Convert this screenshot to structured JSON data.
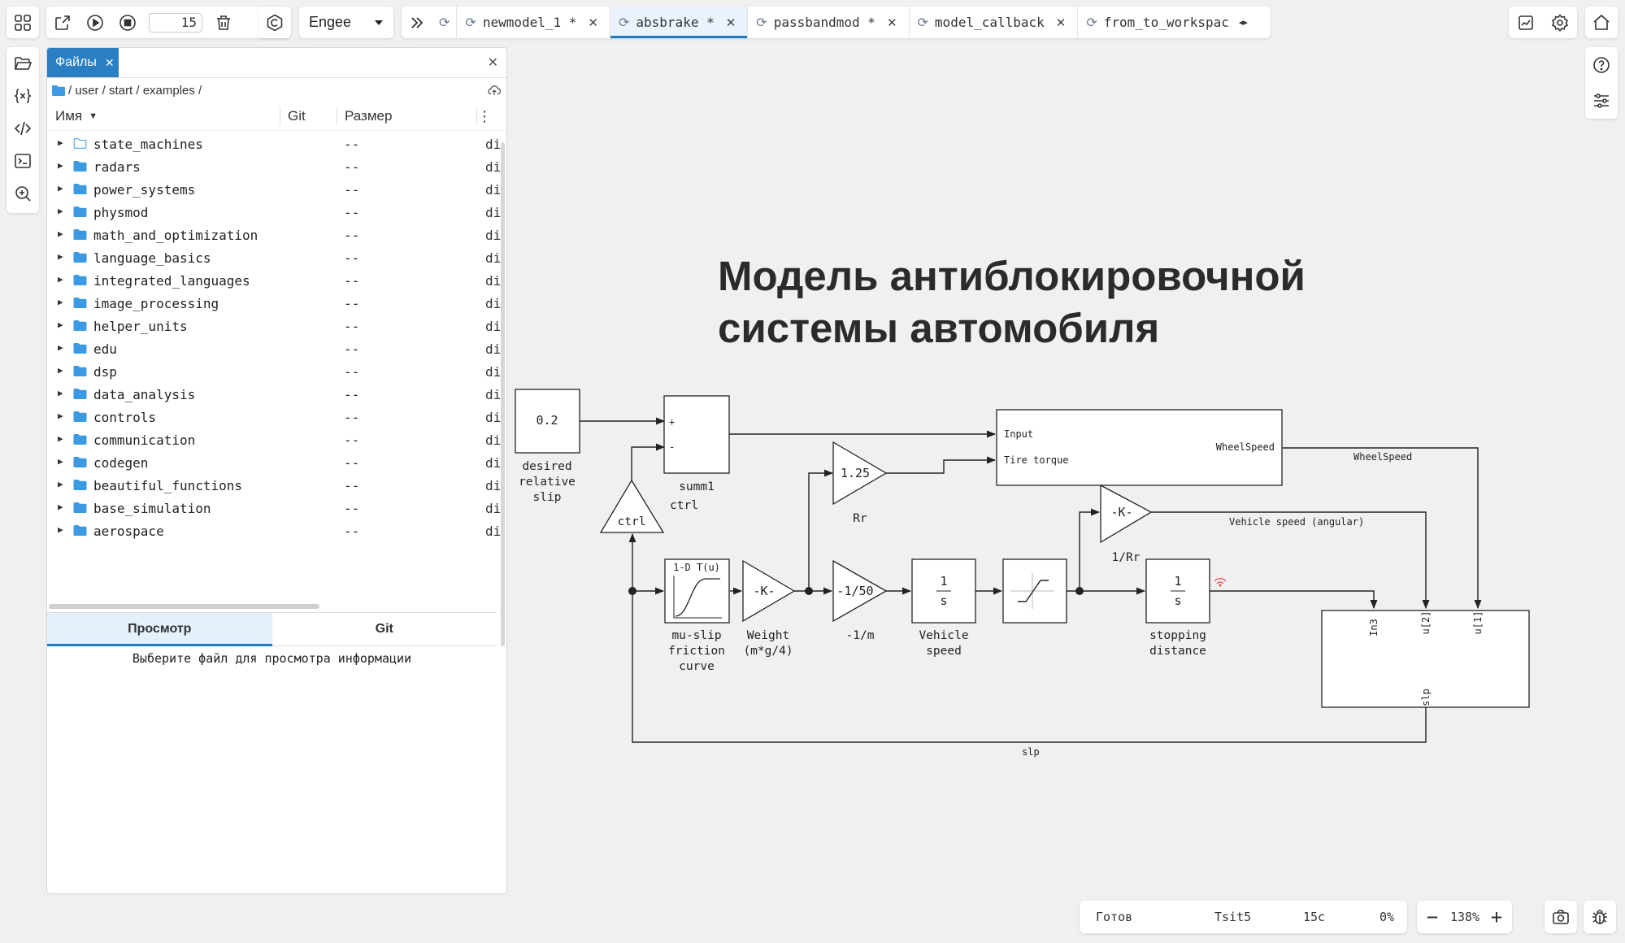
{
  "toolbar": {
    "steps_value": "15",
    "solver_selected": "Engee"
  },
  "tabs": [
    {
      "label": "newmodel_1 *",
      "active": false
    },
    {
      "label": "absbrake *",
      "active": true
    },
    {
      "label": "passbandmod *",
      "active": false
    },
    {
      "label": "model_callback",
      "active": false
    },
    {
      "label": "from_to_workspac",
      "active": false
    }
  ],
  "panel": {
    "tab_label": "Файлы",
    "path": "/ user / start / examples /",
    "columns": {
      "name": "Имя",
      "git": "Git",
      "size": "Размер"
    },
    "files": [
      {
        "name": "state_machines",
        "size": "--",
        "ext": "di"
      },
      {
        "name": "radars",
        "size": "--",
        "ext": "di"
      },
      {
        "name": "power_systems",
        "size": "--",
        "ext": "di"
      },
      {
        "name": "physmod",
        "size": "--",
        "ext": "di"
      },
      {
        "name": "math_and_optimization",
        "size": "--",
        "ext": "di"
      },
      {
        "name": "language_basics",
        "size": "--",
        "ext": "di"
      },
      {
        "name": "integrated_languages",
        "size": "--",
        "ext": "di"
      },
      {
        "name": "image_processing",
        "size": "--",
        "ext": "di"
      },
      {
        "name": "helper_units",
        "size": "--",
        "ext": "di"
      },
      {
        "name": "edu",
        "size": "--",
        "ext": "di"
      },
      {
        "name": "dsp",
        "size": "--",
        "ext": "di"
      },
      {
        "name": "data_analysis",
        "size": "--",
        "ext": "di"
      },
      {
        "name": "controls",
        "size": "--",
        "ext": "di"
      },
      {
        "name": "communication",
        "size": "--",
        "ext": "di"
      },
      {
        "name": "codegen",
        "size": "--",
        "ext": "di"
      },
      {
        "name": "beautiful_functions",
        "size": "--",
        "ext": "di"
      },
      {
        "name": "base_simulation",
        "size": "--",
        "ext": "di"
      },
      {
        "name": "aerospace",
        "size": "--",
        "ext": "di"
      }
    ],
    "subtabs": {
      "preview": "Просмотр",
      "git": "Git"
    },
    "preview_message": "Выберите файл для просмотра информации"
  },
  "diagram": {
    "title_line1": "Модель антиблокировочной",
    "title_line2": "системы автомобиля",
    "blocks": {
      "const_value": "0.2",
      "const_label": [
        "desired",
        "relative",
        "slip"
      ],
      "sum_label": "summ1",
      "sum_plus": "+",
      "sum_minus": "-",
      "ctrl_inner": "ctrl",
      "ctrl_label": "ctrl",
      "rr_value": "1.25",
      "rr_label": "Rr",
      "subsys_in1": "Input",
      "subsys_in2": "Tire torque",
      "subsys_out": "WheelSpeed",
      "wheelspeed_signal": "WheelSpeed",
      "k_value": "-K-",
      "k_label": "1/Rr",
      "vehicle_speed_signal": "Vehicle speed (angular)",
      "lookup_header": "1-D T(u)",
      "lookup_label": [
        "mu-slip",
        "friction",
        "curve"
      ],
      "weight_value": "-K-",
      "weight_label": [
        "Weight",
        "(m*g/4)"
      ],
      "gain_value": "-1/50",
      "gain_label": "-1/m",
      "int1_num": "1",
      "int1_den": "s",
      "int1_label": [
        "Vehicle",
        "speed"
      ],
      "int2_num": "1",
      "int2_den": "s",
      "int2_label": [
        "stopping",
        "distance"
      ],
      "fcn_in1": "In3",
      "fcn_in2": "u[2]",
      "fcn_in3": "u[1]",
      "fcn_out": "slp",
      "slp_signal": "slp"
    }
  },
  "status": {
    "state": "Готов",
    "solver": "Tsit5",
    "time": "15с",
    "progress": "0%"
  },
  "zoom": {
    "level": "138%",
    "minus": "−",
    "plus": "+"
  }
}
